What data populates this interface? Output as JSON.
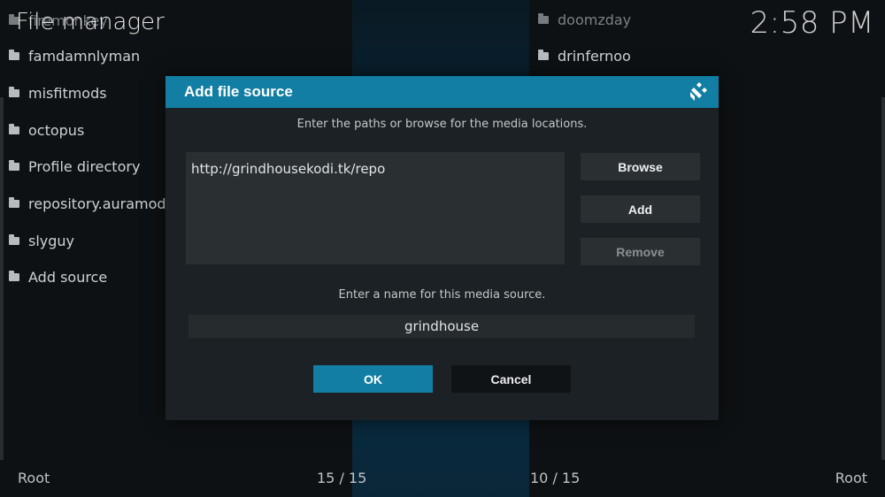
{
  "app": {
    "title": "File manager",
    "clock": "2:58 PM"
  },
  "left_panel": {
    "items": [
      {
        "label": "firemonkey",
        "dim": true
      },
      {
        "label": "famdamnlyman"
      },
      {
        "label": "misfitmods"
      },
      {
        "label": "octopus"
      },
      {
        "label": "Profile directory"
      },
      {
        "label": "repository.auramod"
      },
      {
        "label": "slyguy"
      },
      {
        "label": "Add source"
      }
    ],
    "footer_left": "Root",
    "footer_count": "15 / 15"
  },
  "right_panel": {
    "items": [
      {
        "label": "doomzday",
        "dim": true
      },
      {
        "label": "drinfernoo"
      }
    ],
    "footer_count": "10 / 15",
    "footer_right": "Root"
  },
  "dialog": {
    "title": "Add file source",
    "paths_instruction": "Enter the paths or browse for the media locations.",
    "paths": [
      "http://grindhousekodi.tk/repo"
    ],
    "browse_label": "Browse",
    "add_label": "Add",
    "remove_label": "Remove",
    "name_instruction": "Enter a name for this media source.",
    "name_value": "grindhouse",
    "ok_label": "OK",
    "cancel_label": "Cancel"
  },
  "colors": {
    "accent": "#127ea3",
    "dialog_bg": "#1b2124",
    "field_bg": "#2a2f32"
  },
  "icons": {
    "folder": "folder-icon",
    "logo": "kodi-logo-icon"
  }
}
